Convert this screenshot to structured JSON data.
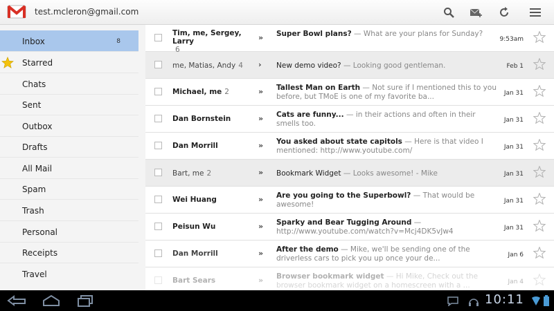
{
  "header": {
    "account_email": "test.mcleron@gmail.com",
    "icons": [
      "search-icon",
      "compose-icon",
      "refresh-icon",
      "menu-icon"
    ]
  },
  "sidebar": {
    "items": [
      {
        "label": "Inbox",
        "count": "8",
        "active": true
      },
      {
        "label": "Starred",
        "icon": "star-icon"
      },
      {
        "label": "Chats"
      },
      {
        "label": "Sent"
      },
      {
        "label": "Outbox"
      },
      {
        "label": "Drafts"
      },
      {
        "label": "All Mail"
      },
      {
        "label": "Spam"
      },
      {
        "label": "Trash"
      },
      {
        "label": "Personal"
      },
      {
        "label": "Receipts"
      },
      {
        "label": "Travel"
      }
    ]
  },
  "messages": [
    {
      "sender": "Tim, me, Sergey, Larry",
      "count": "6",
      "subject": "Super Bowl plans?",
      "snippet": " — What are your plans for Sunday?",
      "date": "9:53am",
      "unread": true
    },
    {
      "sender": "me, Matias, Andy",
      "count": "4",
      "subject": "New demo video?",
      "snippet": " — Looking good gentleman.",
      "date": "Feb 1",
      "unread": false
    },
    {
      "sender": "Michael, me",
      "count": "2",
      "subject": "Tallest Man on Earth",
      "snippet": " — Not sure if I mentioned this to you before, but TMoE is one of my favorite ba...",
      "date": "Jan 31",
      "unread": true
    },
    {
      "sender": "Dan Bornstein",
      "count": "",
      "subject": "Cats are funny...",
      "snippet": " — in their actions and often in their smells too.",
      "date": "Jan 31",
      "unread": true
    },
    {
      "sender": "Dan Morrill",
      "count": "",
      "subject": "You asked about state capitols",
      "snippet": " — Here is that video I mentioned: http://www.youtube.com/",
      "date": "Jan 31",
      "unread": true
    },
    {
      "sender": "Bart, me",
      "count": "2",
      "subject": "Bookmark Widget",
      "snippet": " — Looks awesome! - Mike",
      "date": "Jan 31",
      "unread": false
    },
    {
      "sender": "Wei Huang",
      "count": "",
      "subject": "Are you going to the Superbowl?",
      "snippet": " — That would be awesome!",
      "date": "Jan 31",
      "unread": true
    },
    {
      "sender": "Peisun Wu",
      "count": "",
      "subject": "Sparky and Bear Tugging Around",
      "snippet": " — http://www.youtube.com/watch?v=Mcj4DK5vJw4",
      "date": "Jan 31",
      "unread": true
    },
    {
      "sender": "Dan Morrill",
      "count": "",
      "subject": "After the demo",
      "snippet": " — Mike, we'll be sending one of the driverless cars to pick you up once your de...",
      "date": "Jan 6",
      "unread": false
    },
    {
      "sender": "Bart Sears",
      "count": "",
      "subject": "Browser bookmark widget",
      "snippet": " — Hi Mike, Check out the browser bookmark widget on a homescreen with a ...",
      "date": "Jan 4",
      "unread": false
    }
  ],
  "system_bar": {
    "time": "10:11",
    "icons": [
      "back-icon",
      "home-icon",
      "recent-apps-icon",
      "chat-notification-icon",
      "headset-icon",
      "wifi-icon",
      "battery-icon"
    ]
  }
}
